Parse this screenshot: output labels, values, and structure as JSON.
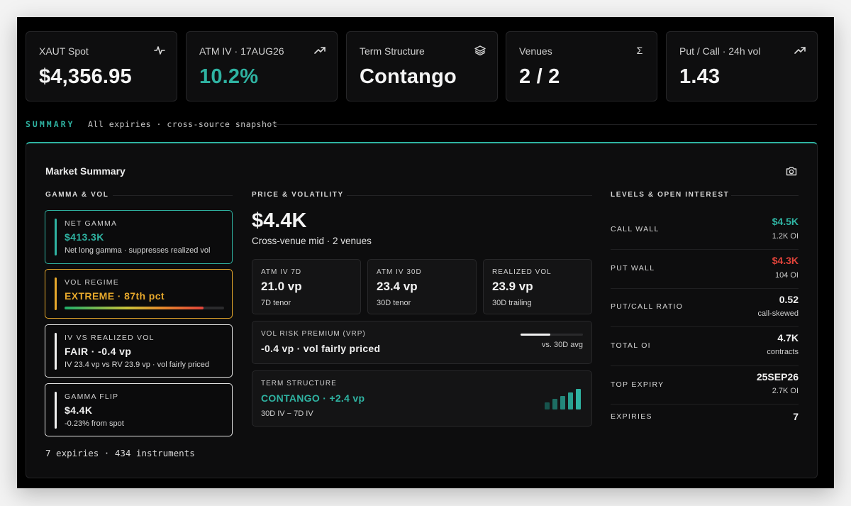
{
  "kpis": [
    {
      "label": "XAUT Spot",
      "value": "$4,356.95",
      "icon": "pulse-icon"
    },
    {
      "label": "ATM IV · 17AUG26",
      "value": "10.2%",
      "icon": "trending-up-icon",
      "accent": "#2fb3a2"
    },
    {
      "label": "Term Structure",
      "value": "Contango",
      "icon": "layers-icon"
    },
    {
      "label": "Venues",
      "value": "2 / 2",
      "icon": "sigma-icon",
      "icon_glyph": "Σ"
    },
    {
      "label": "Put / Call · 24h vol",
      "value": "1.43",
      "icon": "trending-up-icon"
    }
  ],
  "summary": {
    "tag": "SUMMARY",
    "description": "All expiries · cross-source snapshot"
  },
  "panel": {
    "title": "Market Summary",
    "camera_icon": "camera-icon"
  },
  "gamma_vol": {
    "heading": "GAMMA & VOL",
    "net_gamma": {
      "label": "NET GAMMA",
      "value": "$413.3K",
      "sub": "Net long gamma · suppresses realized vol",
      "color": "#2fb3a2"
    },
    "vol_regime": {
      "label": "VOL REGIME",
      "value": "EXTREME · 87th pct",
      "percentile": 0.87,
      "color": "#e6a82c"
    },
    "iv_vs_rv": {
      "label": "IV VS REALIZED VOL",
      "value": "FAIR · -0.4 vp",
      "sub": "IV 23.4 vp vs RV 23.9 vp · vol fairly priced"
    },
    "gamma_flip": {
      "label": "GAMMA FLIP",
      "value": "$4.4K",
      "sub": "-0.23% from spot"
    },
    "footer": "7 expiries · 434 instruments"
  },
  "price_vol": {
    "heading": "PRICE & VOLATILITY",
    "price": "$4.4K",
    "price_sub": "Cross-venue mid · 2 venues",
    "minis": [
      {
        "label": "ATM IV 7D",
        "value": "21.0 vp",
        "sub": "7D tenor"
      },
      {
        "label": "ATM IV 30D",
        "value": "23.4 vp",
        "sub": "30D tenor"
      },
      {
        "label": "REALIZED VOL",
        "value": "23.9 vp",
        "sub": "30D trailing"
      }
    ],
    "vrp": {
      "label": "VOL RISK PREMIUM (VRP)",
      "value": "-0.4 vp · vol fairly priced",
      "note": "vs. 30D avg",
      "level": 0.48
    },
    "term": {
      "label": "TERM STRUCTURE",
      "value": "CONTANGO · +2.4 vp",
      "sub": "30D IV − 7D IV",
      "color": "#2fb3a2"
    }
  },
  "levels": {
    "heading": "LEVELS & OPEN INTEREST",
    "rows": [
      {
        "key": "CALL WALL",
        "value": "$4.5K",
        "sub": "1.2K OI",
        "color": "#2fb3a2"
      },
      {
        "key": "PUT WALL",
        "value": "$4.3K",
        "sub": "104 OI",
        "color": "#e0433a"
      },
      {
        "key": "PUT/CALL RATIO",
        "value": "0.52",
        "sub": "call-skewed"
      },
      {
        "key": "TOTAL OI",
        "value": "4.7K",
        "sub": "contracts"
      },
      {
        "key": "TOP EXPIRY",
        "value": "25SEP26",
        "sub": "2.7K OI"
      },
      {
        "key": "EXPIRIES",
        "value": "7"
      }
    ]
  }
}
